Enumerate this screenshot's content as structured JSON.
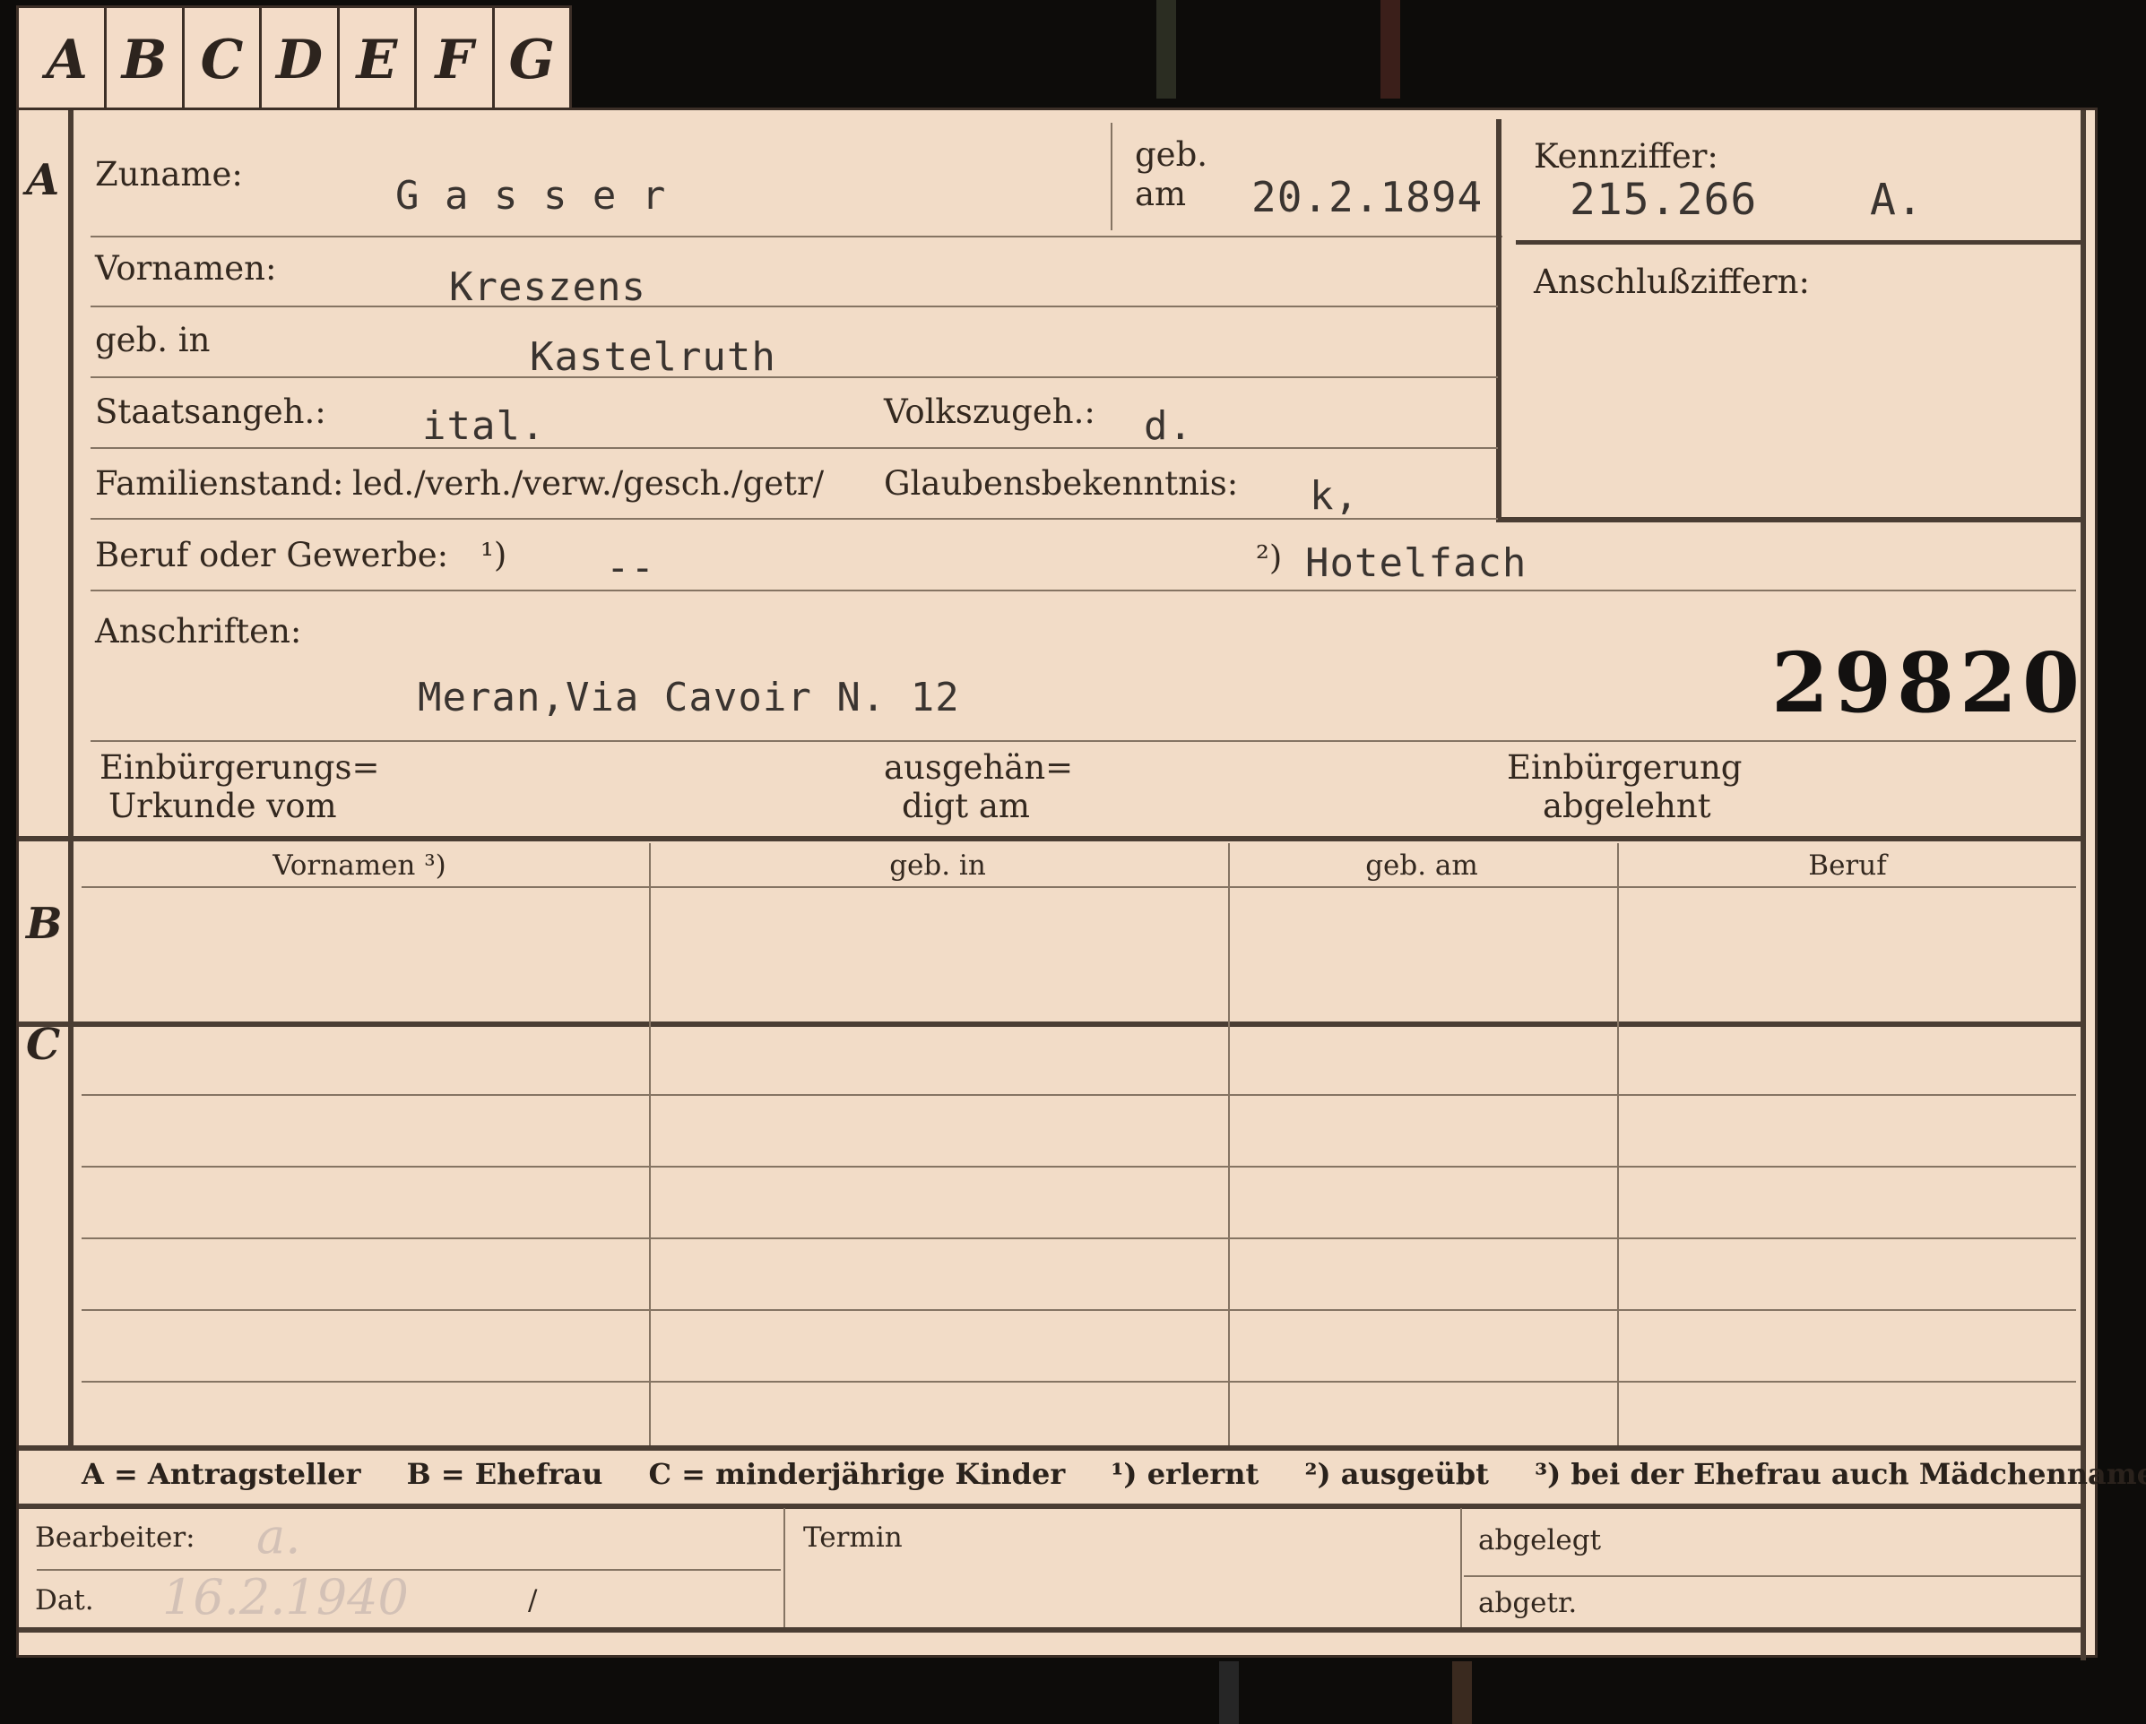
{
  "tabs": [
    "A",
    "B",
    "C",
    "D",
    "E",
    "F",
    "G"
  ],
  "sections": {
    "a": "A",
    "b": "B",
    "c": "C"
  },
  "fields": {
    "zuname_label": "Zuname:",
    "zuname_value": "G a s s e r",
    "geb_label_top": "geb.",
    "geb_label_bottom": "am",
    "geb_am_value": "20.2.1894",
    "kennziffer_label": "Kennziffer:",
    "kennziffer_value": "215.266",
    "kennziffer_suffix": "A.",
    "anschluss_label": "Anschlußziffern:",
    "vornamen_label": "Vornamen:",
    "vornamen_value": "Kreszens",
    "geb_in_label": "geb. in",
    "geb_in_value": "Kastelruth",
    "staatsangeh_label": "Staatsangeh.:",
    "staatsangeh_value": "ital.",
    "volkszugeh_label": "Volkszugeh.:",
    "volkszugeh_value": "d.",
    "familienstand_label": "Familienstand:",
    "familienstand_options": "led./verh./verw./gesch./getr/",
    "glaubens_label": "Glaubensbekenntnis:",
    "glaubens_value": "k,",
    "beruf_label": "Beruf oder Gewerbe:",
    "beruf_marker1": "¹)",
    "beruf_value1": "--",
    "beruf_marker2": "²)",
    "beruf_value2": "Hotelfach",
    "anschriften_label": "Anschriften:",
    "anschriften_value": "Meran,Via Cavoir N. 12",
    "card_number": "29820",
    "einb_label_1": "Einbürgerungs=",
    "einb_label_2": "Urkunde vom",
    "ausgeh_label_1": "ausgehän=",
    "ausgeh_label_2": "digt am",
    "abgelehnt_label_1": "Einbürgerung",
    "abgelehnt_label_2": "abgelehnt"
  },
  "table_headers": [
    "Vornamen ³)",
    "geb. in",
    "geb. am",
    "Beruf"
  ],
  "legend": {
    "a": "A = Antragsteller",
    "b": "B = Ehefrau",
    "c": "C = minderjährige Kinder",
    "n1": "¹) erlernt",
    "n2": "²) ausgeübt",
    "n3": "³) bei der Ehefrau auch Mädchenname"
  },
  "footer": {
    "bearbeiter_label": "Bearbeiter:",
    "bearbeiter_value": "a.",
    "dat_label": "Dat.",
    "dat_value": "16.2.1940",
    "dat_slash": "/",
    "termin_label": "Termin",
    "abgelegt_label": "abgelegt",
    "abgetr_label": "abgetr."
  }
}
